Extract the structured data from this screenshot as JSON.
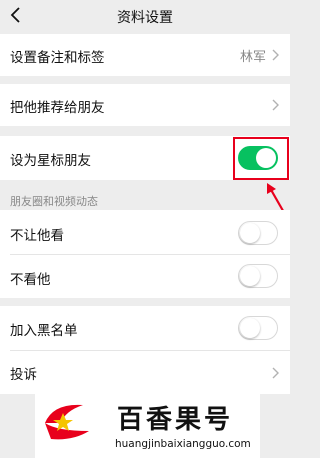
{
  "header": {
    "title": "资料设置",
    "back_icon": "chevron-left-icon"
  },
  "rows": {
    "remark": {
      "label": "设置备注和标签",
      "value": "林军"
    },
    "recommend": {
      "label": "把他推荐给朋友"
    },
    "star": {
      "label": "设为星标朋友",
      "toggle_on": true
    },
    "hide_moments": {
      "label": "不让他看",
      "toggle_on": false
    },
    "hide_his": {
      "label": "不看他",
      "toggle_on": false
    },
    "blacklist": {
      "label": "加入黑名单",
      "toggle_on": false
    },
    "complain": {
      "label": "投诉"
    }
  },
  "section": {
    "moments_title": "朋友圈和视频动态"
  },
  "colors": {
    "toggle_on": "#07c160",
    "highlight": "#e8001c",
    "background": "#ededed"
  },
  "watermark": {
    "title": "百香果号",
    "url": "huangjinbaixiangguo.com"
  }
}
